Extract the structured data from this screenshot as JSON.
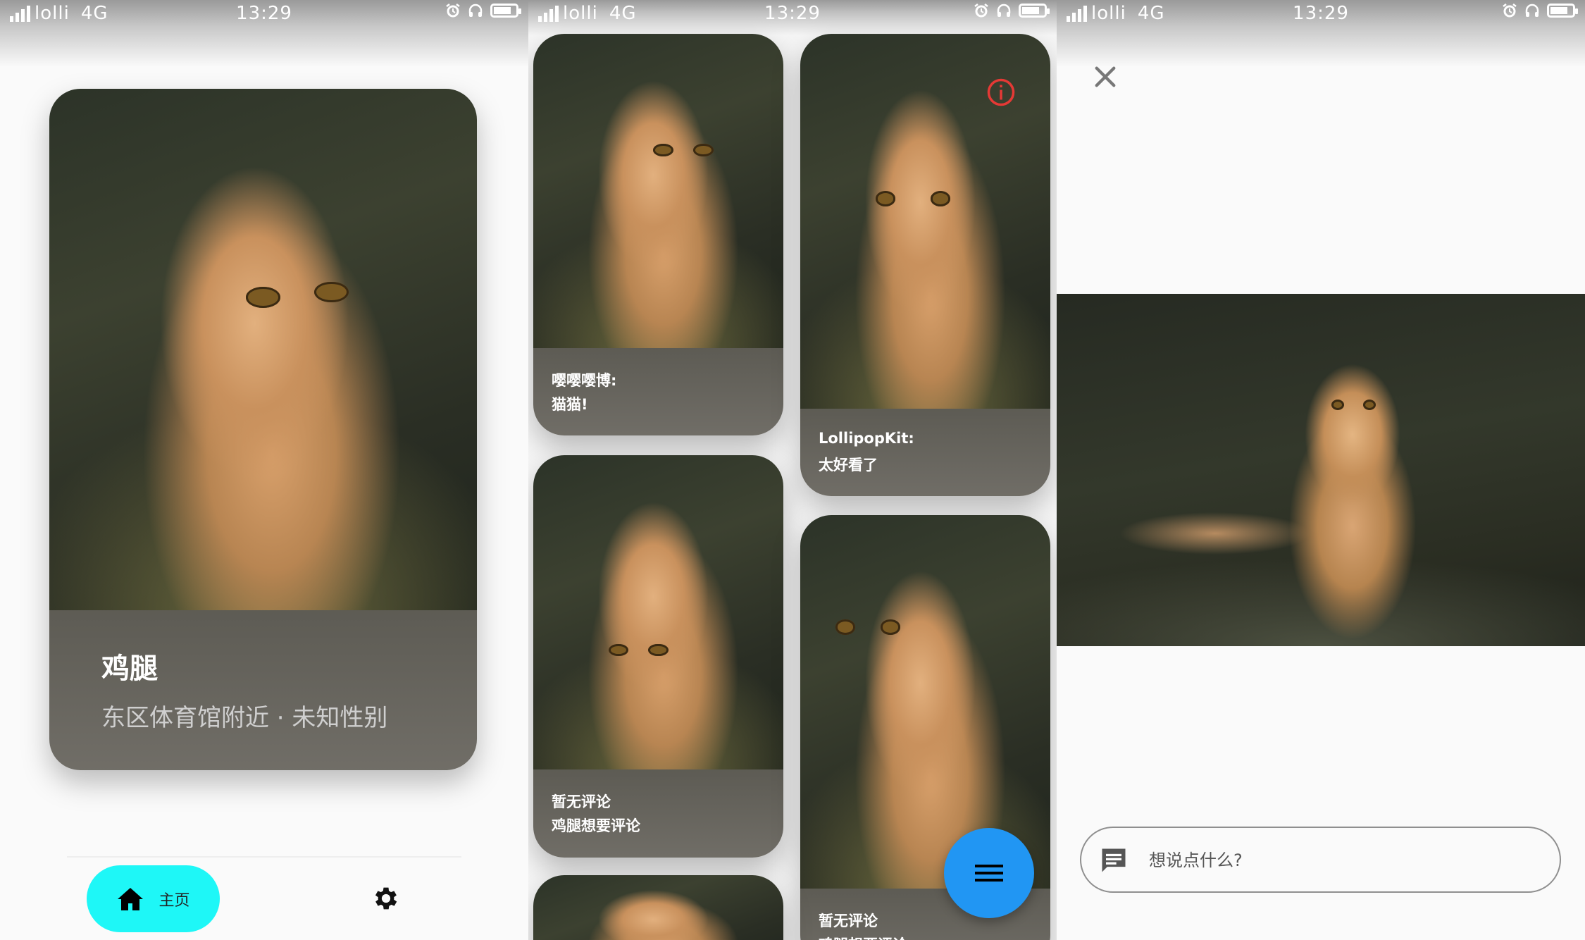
{
  "status_bar": {
    "carrier": "lolli",
    "network": "4G",
    "time": "13:29",
    "icons": [
      "signal-icon",
      "alarm-icon",
      "headphones-icon",
      "battery-icon"
    ]
  },
  "home": {
    "card": {
      "name": "鸡腿",
      "subtitle": "东区体育馆附近 · 未知性别"
    },
    "nav": {
      "home_label": "主页",
      "home_icon": "home-icon",
      "settings_icon": "gear-icon",
      "active_color": "#1ef7f7"
    }
  },
  "feed": {
    "cards": [
      {
        "line1": "嘤嘤嘤博:",
        "line2": "猫猫!"
      },
      {
        "line1": "LollipopKit:",
        "line2": "太好看了"
      },
      {
        "line1": "暂无评论",
        "line2": "鸡腿想要评论"
      },
      {
        "line1": "暂无评论",
        "line2": "鸡腿想要评论"
      }
    ],
    "info_icon": "info-icon",
    "fab_icon": "menu-icon",
    "fab_color": "#2196f3"
  },
  "detail": {
    "close_icon": "close-icon",
    "comment_icon": "comment-icon",
    "comment_placeholder": "想说点什么?"
  }
}
